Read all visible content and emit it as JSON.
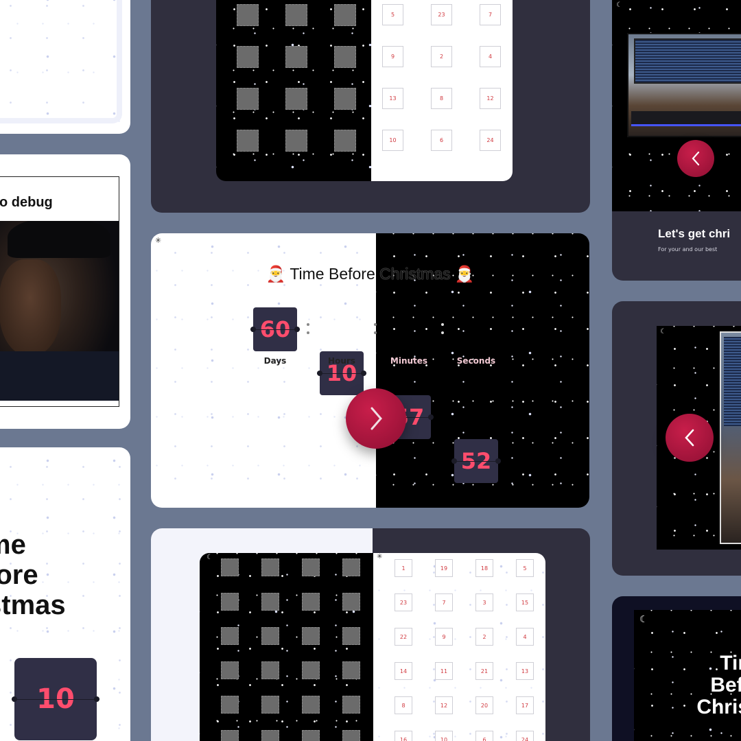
{
  "app": {
    "title": "Time Before Christmas"
  },
  "countdown": {
    "heading": "Time Before Christmas",
    "santa_emoji": "🎅",
    "units": [
      {
        "value": "60",
        "label": "Days"
      },
      {
        "value": "10",
        "label": "Hours"
      },
      {
        "value": "57",
        "label": "Minutes"
      },
      {
        "value": "52",
        "label": "Seconds"
      }
    ],
    "next_icon": "chevron-right-icon"
  },
  "left_column": {
    "meme_caption": "o debug",
    "large_title_lines": [
      "me",
      "fore",
      "stmas"
    ],
    "large_flip_value": "10"
  },
  "top_calendar": {
    "light_numbers": [
      "5",
      "23",
      "7",
      "9",
      "2",
      "4",
      "13",
      "8",
      "12",
      "10",
      "6",
      "24"
    ]
  },
  "bottom_calendar": {
    "light_numbers": [
      "1",
      "19",
      "18",
      "5",
      "23",
      "7",
      "3",
      "15",
      "22",
      "9",
      "2",
      "4",
      "14",
      "11",
      "21",
      "13",
      "8",
      "12",
      "20",
      "17",
      "16",
      "10",
      "6",
      "24"
    ]
  },
  "right_column": {
    "promo_title": "Let's get chri",
    "promo_subtitle": "For your and our best",
    "dark_title_lines": [
      "Tim",
      "Befo",
      "Christ"
    ],
    "prev_icon": "chevron-left-icon",
    "moon_icon": "moon-icon"
  },
  "colors": {
    "accent": "#c81e4a",
    "digit": "#ff4d6d",
    "background": "#6b7891",
    "panel_dark": "#302f3e"
  }
}
